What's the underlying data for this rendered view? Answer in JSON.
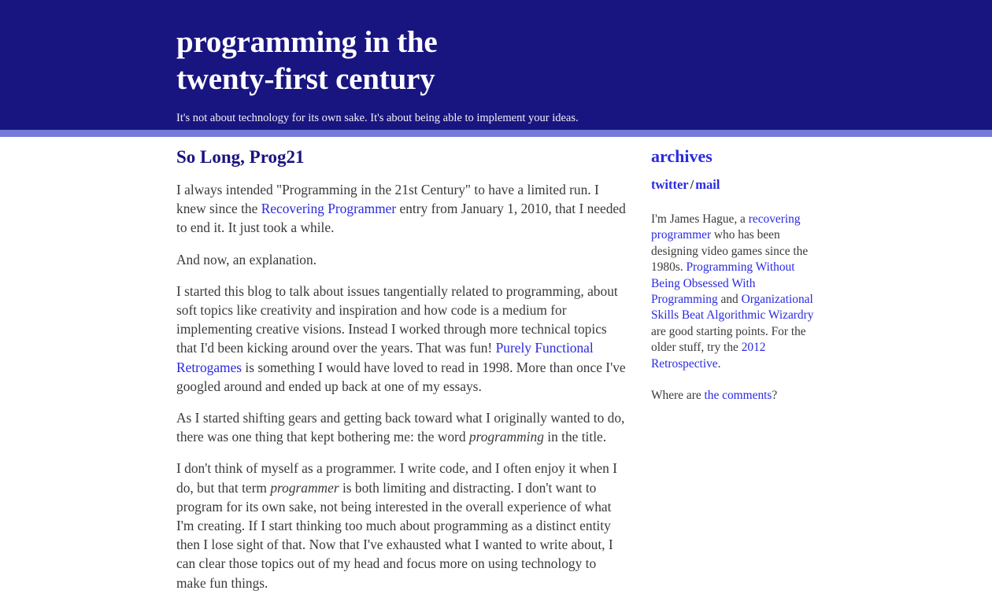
{
  "header": {
    "title_line1": "programming in the",
    "title_line2": "twenty-first century",
    "tagline": "It's not about technology for its own sake. It's about being able to implement your ideas.",
    "background_color": "#191580",
    "band_color": "#7579d8"
  },
  "post": {
    "title": "So Long, Prog21",
    "paragraphs": {
      "p1_a": "I always intended \"Programming in the 21st Century\" to have a limited run. I knew since the ",
      "p1_link": "Recovering Programmer",
      "p1_b": " entry from January 1, 2010, that I needed to end it. It just took a while.",
      "p2": "And now, an explanation.",
      "p3_a": "I started this blog to talk about issues tangentially related to programming, about soft topics like creativity and inspiration and how code is a medium for implementing creative visions. Instead I worked through more technical topics that I'd been kicking around over the years. That was fun! ",
      "p3_link": "Purely Functional Retrogames",
      "p3_b": " is something I would have loved to read in 1998. More than once I've googled around and ended up back at one of my essays.",
      "p4_a": "As I started shifting gears and getting back toward what I originally wanted to do, there was one thing that kept bothering me: the word ",
      "p4_em": "programming",
      "p4_b": " in the title.",
      "p5_a": "I don't think of myself as a programmer. I write code, and I often enjoy it when I do, but that term ",
      "p5_em": "programmer",
      "p5_b": " is both limiting and distracting. I don't want to program for its own sake, not being interested in the overall experience of what I'm creating. If I start thinking too much about programming as a distinct entity then I lose sight of that. Now that I've exhausted what I wanted to write about, I can clear those topics out of my head and focus more on using technology to make fun things."
    }
  },
  "sidebar": {
    "archives_label": "archives",
    "twitter_label": "twitter",
    "separator": "/",
    "mail_label": "mail",
    "bio": {
      "a": "I'm James Hague, a ",
      "link1": "recovering programmer",
      "b": " who has been designing video games since the 1980s. ",
      "link2": "Programming Without Being Obsessed With Programming",
      "c": " and ",
      "link3": "Organizational Skills Beat Algorithmic Wizardry",
      "d": " are good starting points. For the older stuff, try the ",
      "link4": "2012 Retrospective",
      "e": "."
    },
    "comments": {
      "a": "Where are ",
      "link": "the comments",
      "b": "?"
    }
  },
  "colors": {
    "link": "#2a2ae0",
    "heading_navy": "#1a1580",
    "body_text": "#3a3a3a"
  }
}
